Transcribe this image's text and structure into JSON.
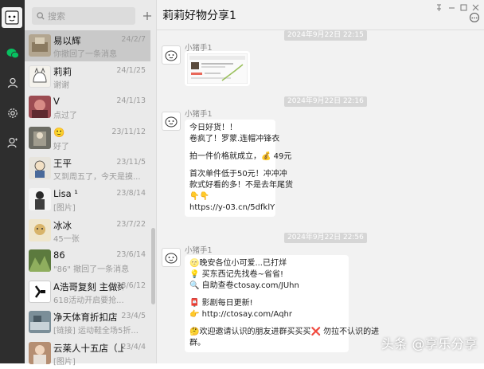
{
  "search": {
    "placeholder": "搜索"
  },
  "chats": [
    {
      "name": "易以辉",
      "preview": "你撤回了一条消息",
      "date": "24/2/7",
      "active": true,
      "color": "#b3a690"
    },
    {
      "name": "莉莉",
      "preview": "谢谢",
      "date": "24/1/25",
      "color": "#f4f2ec"
    },
    {
      "name": "V",
      "preview": "点过了",
      "date": "24/1/13",
      "color": "#9c4c52"
    },
    {
      "name": "🙂",
      "preview": "好了",
      "date": "23/11/12",
      "color": "#6c6c64"
    },
    {
      "name": "王平",
      "preview": "又到周五了，今天是摸...",
      "date": "23/11/5",
      "color": "#e7e4dc"
    },
    {
      "name": "Lisa ¹",
      "preview": "[图片]",
      "date": "23/8/14",
      "color": "#3e3e3e"
    },
    {
      "name": "冰冰",
      "preview": "45一张",
      "date": "23/7/22",
      "color": "#c8b27c"
    },
    {
      "name": "86",
      "preview": "\"86\" 撤回了一条消息",
      "date": "23/6/14",
      "color": "#5c7a3e"
    },
    {
      "name": "A浩哥复刻 主做纯原...",
      "preview": "618活动开启要抢...",
      "date": "23/6/12",
      "color": "#1c1c1c"
    },
    {
      "name": "净天体育折扣店",
      "preview": "[链接] 运动鞋全场5折...",
      "date": "23/4/5",
      "color": "#7b8e98"
    },
    {
      "name": "云莱人十五店（上班...",
      "preview": "[图片]",
      "date": "23/4/4",
      "color": "#b58e72"
    }
  ],
  "chat": {
    "title": "莉莉好物分享1",
    "messages": [
      {
        "time": "2024年9月22日 22:15",
        "sender": "小猪手1",
        "type": "image"
      },
      {
        "time": "2024年9月22日 22:16",
        "sender": "小猪手1",
        "type": "text",
        "lines": [
          "今日好货！！",
          "卷疯了！罗蒙.连帽冲锋衣",
          "",
          "拍一件价格就成立，💰 49元",
          "",
          "首次单件低于50元！冲冲冲",
          "款式好看的多！不是去年尾货",
          "👇👇",
          "https://y-03.cn/5dfklY"
        ]
      },
      {
        "time": "2024年9月22日 22:56",
        "sender": "小猪手1",
        "type": "text",
        "lines": [
          "🌝晚安各位小可爱...已打烊",
          "💡 买东西记先找卷~省省!",
          "🔍 自助查卷ctosay.com/JUhn",
          "",
          "📮 影剧每日更新!",
          "👉 http://ctosay.com/Aqhr",
          "",
          "🤔欢迎邀请认识的朋友进群买买买❌ 勿拉不认识的进",
          "群。"
        ]
      }
    ]
  },
  "watermark": "头条 @享乐分享",
  "colors": {
    "rail": "#2e2e2e",
    "list_bg": "#eaeaea",
    "chat_bg": "#f2f2f2",
    "active_item": "#c9c9c9",
    "accent_green": "#07c160"
  }
}
